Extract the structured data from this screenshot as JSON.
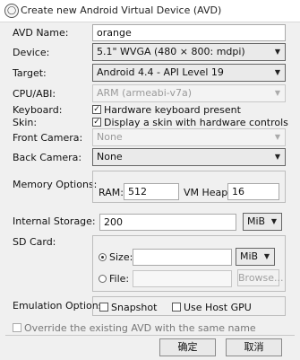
{
  "window": {
    "title": "Create new Android Virtual Device (AVD)",
    "icon": "android-sdk-icon"
  },
  "avd_name": {
    "label": "AVD Name:",
    "value": "orange"
  },
  "device": {
    "label": "Device:",
    "value": "5.1\" WVGA (480 × 800: mdpi)"
  },
  "target": {
    "label": "Target:",
    "value": "Android 4.4 - API Level 19"
  },
  "cpu_abi": {
    "label": "CPU/ABI:",
    "value": "ARM (armeabi-v7a)"
  },
  "keyboard": {
    "label": "Keyboard:",
    "option": "Hardware keyboard present",
    "checked": true
  },
  "skin": {
    "label": "Skin:",
    "option": "Display a skin with hardware controls",
    "checked": true
  },
  "front_camera": {
    "label": "Front Camera:",
    "value": "None"
  },
  "back_camera": {
    "label": "Back Camera:",
    "value": "None"
  },
  "memory": {
    "label": "Memory Options:",
    "ram_label": "RAM:",
    "ram_value": "512",
    "vm_heap_label": "VM Heap:",
    "vm_heap_value": "16"
  },
  "internal_storage": {
    "label": "Internal Storage:",
    "value": "200",
    "unit": "MiB"
  },
  "sd_card": {
    "label": "SD Card:",
    "size_label": "Size:",
    "size_value": "",
    "size_unit": "MiB",
    "size_selected": true,
    "file_label": "File:",
    "file_value": "",
    "browse_label": "Browse..."
  },
  "emulation": {
    "label": "Emulation Options:",
    "snapshot_label": "Snapshot",
    "snapshot_checked": false,
    "host_gpu_label": "Use Host GPU",
    "host_gpu_checked": false
  },
  "override": {
    "label": "Override the existing AVD with the same name",
    "checked": false
  },
  "buttons": {
    "ok": "确定",
    "cancel": "取消"
  }
}
